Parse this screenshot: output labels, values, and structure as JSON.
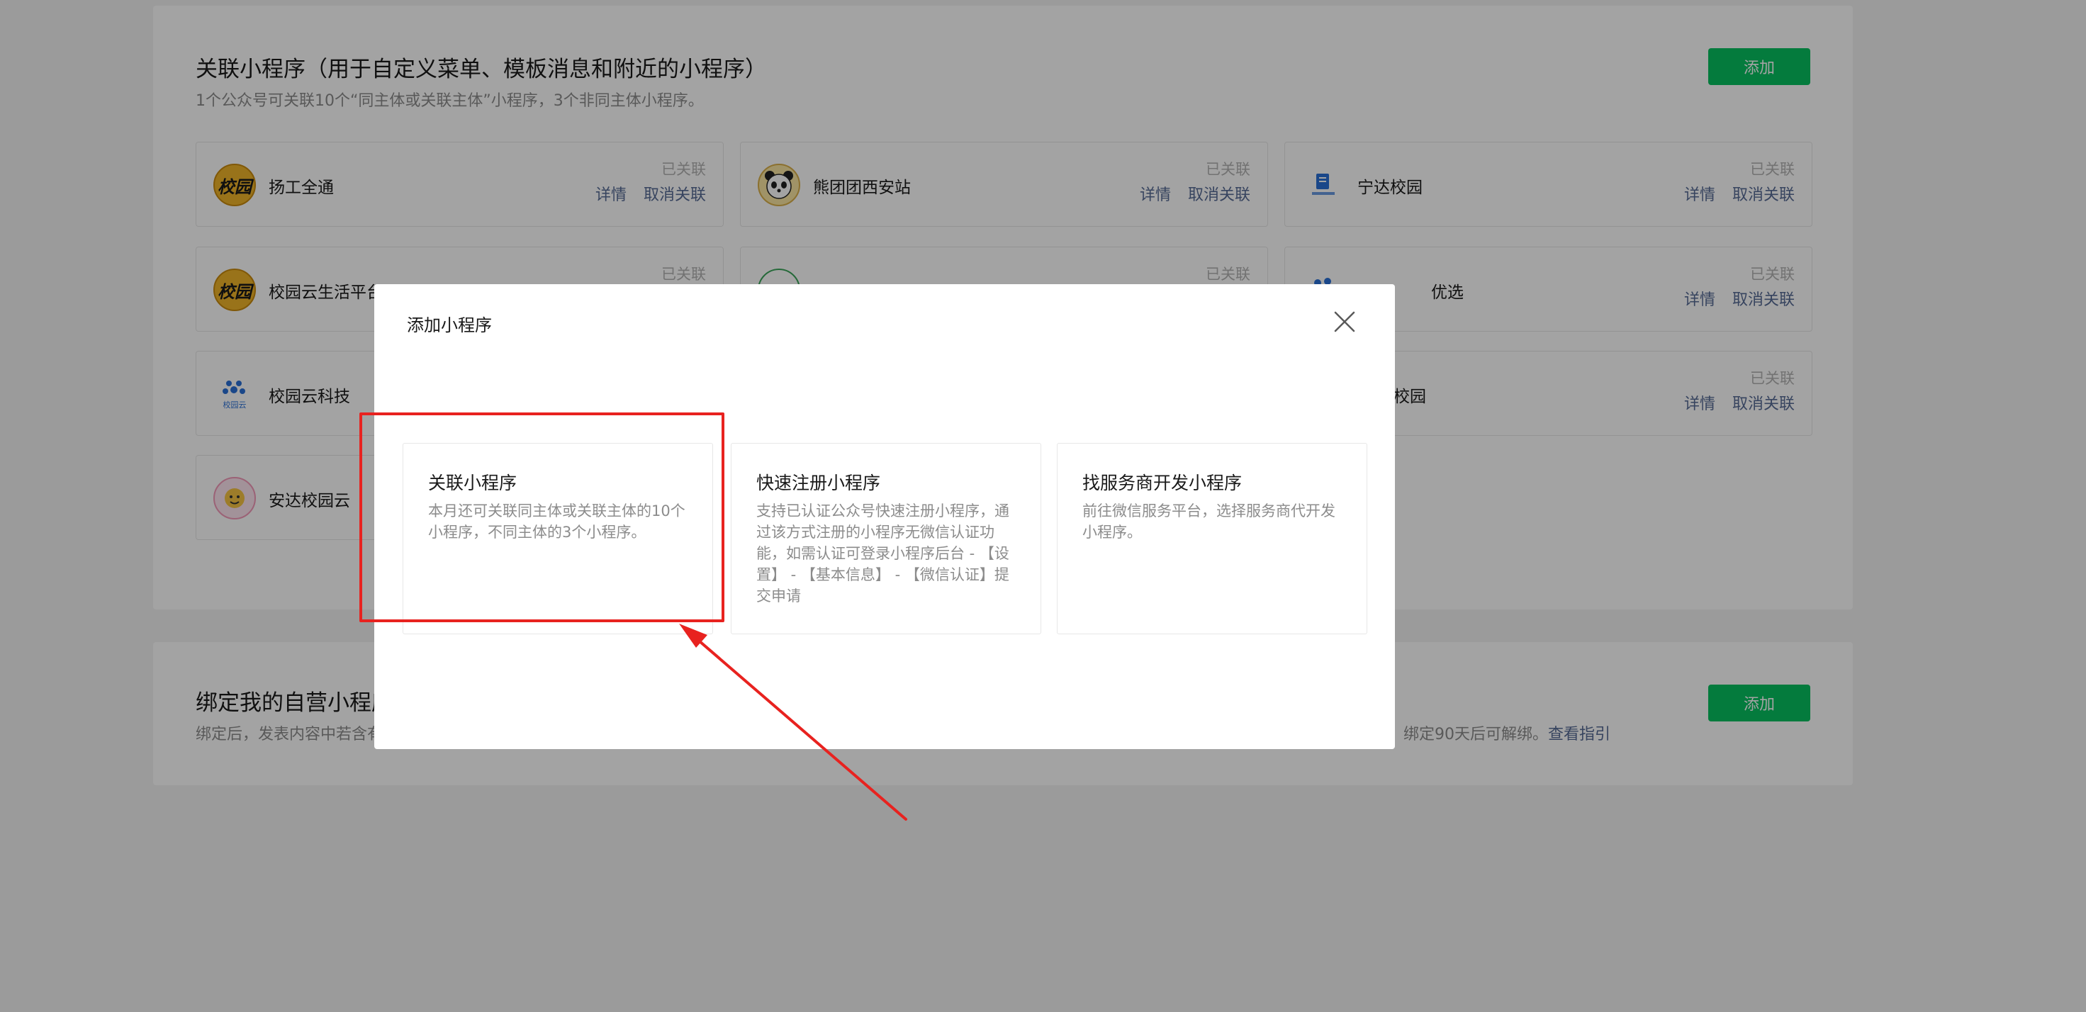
{
  "section1": {
    "title": "关联小程序（用于自定义菜单、模板消息和附近的小程序）",
    "desc": "1个公众号可关联10个“同主体或关联主体”小程序，3个非同主体小程序。",
    "add_label": "添加",
    "cards": [
      {
        "name": "扬工全通",
        "status": "已关联",
        "detail": "详情",
        "unlink": "取消关联",
        "logo_icon": "xiaoyuan-logo-icon",
        "logo_text": "校园"
      },
      {
        "name": "熊团团西安站",
        "status": "已关联",
        "detail": "详情",
        "unlink": "取消关联",
        "logo_icon": "panda-logo-icon"
      },
      {
        "name": "宁达校园",
        "status": "已关联",
        "detail": "详情",
        "unlink": "取消关联",
        "logo_icon": "ningda-logo-icon"
      },
      {
        "name": "校园云生活平台",
        "status": "已关联",
        "logo_icon": "xiaoyuan-logo-icon",
        "logo_text": "校园"
      },
      {
        "status": "已关联",
        "logo_icon": "green-seal-logo-icon"
      },
      {
        "name": "优选",
        "status": "已关联",
        "detail": "详情",
        "unlink": "取消关联",
        "logo_icon": "yun-logo-icon"
      },
      {
        "name": "校园云科技",
        "logo_icon": "yun-logo-icon",
        "logo_text": "校园云"
      },
      {
        "name": "慧校园",
        "status": "已关联",
        "detail": "详情",
        "unlink": "取消关联"
      },
      {
        "name": "安达校园云",
        "logo_icon": "anda-logo-icon"
      }
    ]
  },
  "section2": {
    "title": "绑定我的自营小程序",
    "desc_start": "绑定后，发表内容中若含有",
    "desc_end": "绑定90天后可解绑。",
    "guide_link": "查看指引",
    "add_label": "添加"
  },
  "dialog": {
    "title": "添加小程序",
    "close_icon": "close-icon",
    "options": [
      {
        "title": "关联小程序",
        "desc": "本月还可关联同主体或关联主体的10个小程序，不同主体的3个小程序。"
      },
      {
        "title": "快速注册小程序",
        "desc": "支持已认证公众号快速注册小程序，通过该方式注册的小程序无微信认证功能，如需认证可登录小程序后台 - 【设置】 - 【基本信息】 - 【微信认证】提交申请"
      },
      {
        "title": "找服务商开发小程序",
        "desc": "前往微信服务平台，选择服务商代开发小程序。"
      }
    ]
  },
  "annotation": {
    "color": "#e8221f"
  },
  "colors": {
    "primary": "#07c160",
    "link": "#576b95",
    "muted": "#8c8c8c",
    "status": "#b2b2b2"
  }
}
